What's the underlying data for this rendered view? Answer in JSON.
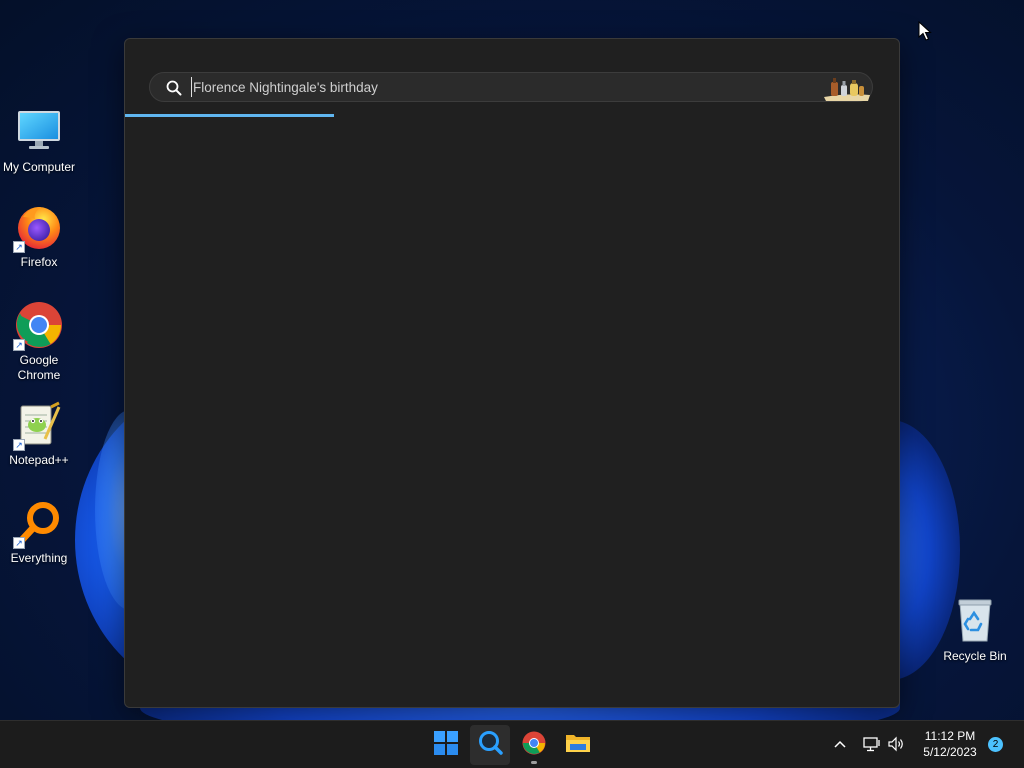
{
  "desktop": {
    "icons": [
      {
        "label": "My Computer",
        "icon": "monitor-icon"
      },
      {
        "label": "Firefox",
        "icon": "firefox-icon"
      },
      {
        "label": "Google Chrome",
        "icon": "chrome-icon"
      },
      {
        "label": "Notepad++",
        "icon": "notepadpp-icon"
      },
      {
        "label": "Everything",
        "icon": "everything-icon"
      },
      {
        "label": "Recycle Bin",
        "icon": "recycle-bin-icon"
      }
    ]
  },
  "search": {
    "query": "Florence Nightingale's birthday",
    "progress": 0.27
  },
  "taskbar": {
    "apps": [
      "windows-start-icon",
      "search-app-icon",
      "chrome-icon",
      "file-explorer-icon"
    ],
    "time": "11:12 PM",
    "date": "5/12/2023",
    "notifications": "2"
  },
  "colors": {
    "accent": "#60b6f0",
    "window_bg": "#202020",
    "taskbar_bg": "#1c1c1c"
  }
}
